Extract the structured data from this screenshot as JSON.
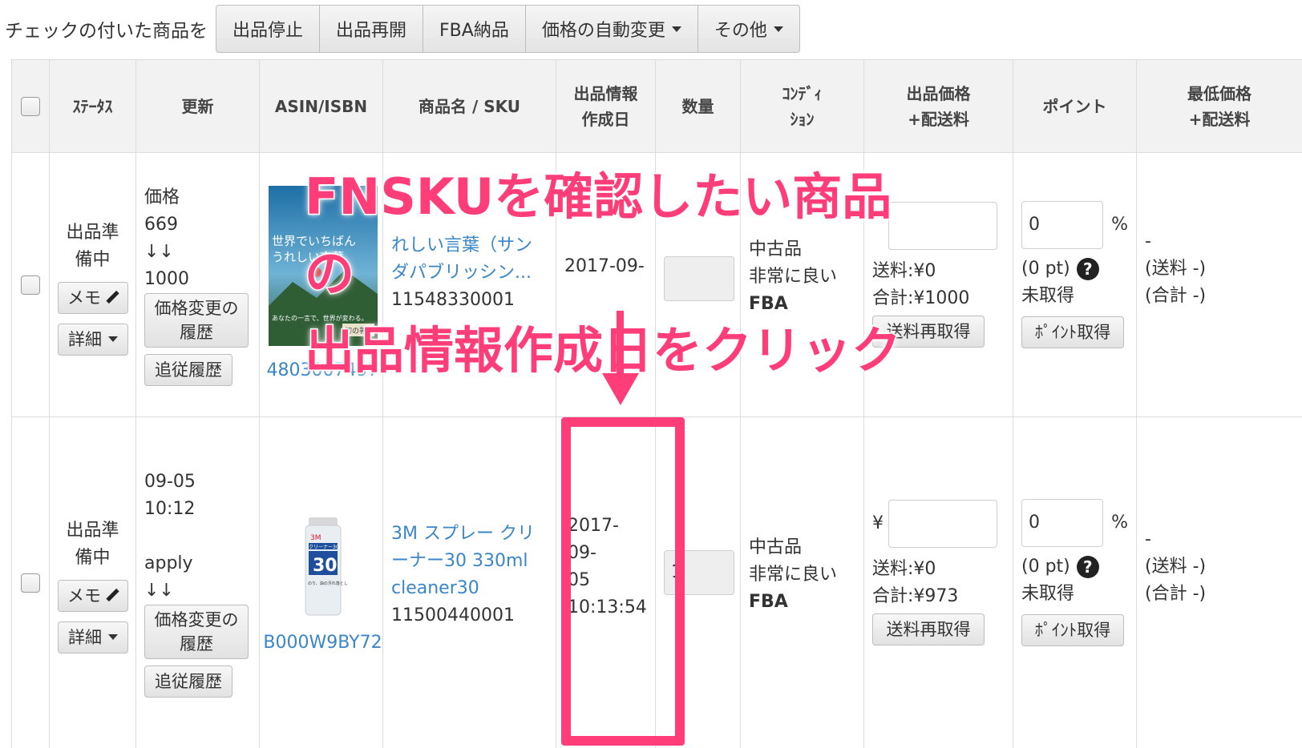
{
  "toolbar": {
    "label": "チェックの付いた商品を",
    "buttons": [
      "出品停止",
      "出品再開",
      "FBA納品",
      "価格の自動変更",
      "その他"
    ]
  },
  "table": {
    "headers": {
      "status": "ｽﾃｰﾀｽ",
      "update": "更新",
      "asin": "ASIN/ISBN",
      "name": "商品名 / SKU",
      "created_l1": "出品情報",
      "created_l2": "作成日",
      "qty": "数量",
      "cond_l1": "ｺﾝﾃﾞｨ",
      "cond_l2": "ｼｮﾝ",
      "price_l1": "出品価格",
      "price_l2": "+配送料",
      "points": "ポイント",
      "lowest_l1": "最低価格",
      "lowest_l2": "+配送料"
    },
    "rows": [
      {
        "status_l1": "出品準",
        "status_l2": "備中",
        "memo": "メモ",
        "detail": "詳細",
        "update_l1": "価格",
        "update_l2": "669",
        "update_l3": "↓↓",
        "update_l4": "1000",
        "history_l1": "価格変更の",
        "history_l2": "履歴",
        "follow": "追従履歴",
        "asin": "4803007497",
        "book_t1": "世界でいちばん",
        "book_t2": "うれしい言葉",
        "book_sub": "あなたの一言で、世界が変わる。",
        "book_tag": "初の著書",
        "name_l1": "れしい言葉（サン",
        "name_l2": "ダパブリッシン...",
        "sku": "11548330001",
        "created": "2017-09-",
        "qty": "",
        "cond_l1": "中古品",
        "cond_l2": "非常に良い",
        "cond_l3": "FBA",
        "price_value": "",
        "shipping": "送料:¥0",
        "total": "合計:¥1000",
        "ship_btn": "送料再取得",
        "point_value": "0",
        "percent": "%",
        "pt": "(0 pt)",
        "point_status": "未取得",
        "point_btn": "ﾎﾟｲﾝﾄ取得",
        "low_l1": "-",
        "low_l2": "(送料 -)",
        "low_l3": "(合計 -)"
      },
      {
        "status_l1": "出品準",
        "status_l2": "備中",
        "memo": "メモ",
        "detail": "詳細",
        "update_l1": "09-05 10:12",
        "update_l2": "apply",
        "update_l3": "↓↓",
        "history_l1": "価格変更の",
        "history_l2": "履歴",
        "follow": "追従履歴",
        "asin": "B000W9BY72",
        "can_brand": "3M",
        "can_label": "クリーナー30",
        "can_num": "30",
        "can_desc": "のり、油の汚れ落とし",
        "name_l1": "3M スプレー クリ",
        "name_l2": "ーナー30 330ml",
        "name_l3": "cleaner30",
        "sku": "11500440001",
        "created_l1": "2017-09-",
        "created_l2": "05",
        "created_l3": "10:13:54",
        "qty": "1",
        "cond_l1": "中古品",
        "cond_l2": "非常に良い",
        "cond_l3": "FBA",
        "yen": "¥",
        "price_value": "",
        "shipping": "送料:¥0",
        "total": "合計:¥973",
        "ship_btn": "送料再取得",
        "point_value": "0",
        "percent": "%",
        "pt": "(0 pt)",
        "point_status": "未取得",
        "point_btn": "ﾎﾟｲﾝﾄ取得",
        "low_l1": "-",
        "low_l2": "(送料 -)",
        "low_l3": "(合計 -)"
      }
    ]
  },
  "annotation": {
    "line1": "FNSKUを確認したい商品の",
    "line2": "出品情報作成日をクリック",
    "color": "#ff3d78"
  },
  "icons": {
    "pencil": "pencil-icon",
    "caret": "caret-down-icon",
    "help": "question-circle-icon",
    "help_glyph": "?"
  }
}
